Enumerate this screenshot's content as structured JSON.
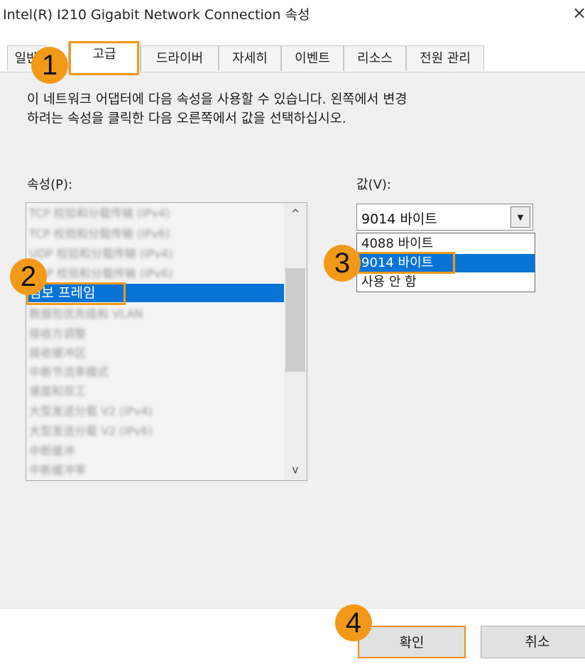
{
  "window": {
    "title": "Intel(R) I210 Gigabit Network Connection 속성",
    "close_glyph": "×"
  },
  "tabs": [
    {
      "label": "일반",
      "active": false
    },
    {
      "label": "고급",
      "active": true
    },
    {
      "label": "드라이버",
      "active": false
    },
    {
      "label": "자세히",
      "active": false
    },
    {
      "label": "이벤트",
      "active": false
    },
    {
      "label": "리소스",
      "active": false
    },
    {
      "label": "전원 관리",
      "active": false
    }
  ],
  "description": {
    "line1": "이 네트워크 어댑터에 다음 속성을 사용할 수 있습니다. 왼쪽에서 변경",
    "line2": "하려는 속성을 클릭한 다음 오른쪽에서 값을 선택하십시오."
  },
  "property_label": "속성(P):",
  "value_label": "값(V):",
  "properties": [
    {
      "label": "TCP 校验和分载传输 (IPv4)",
      "blurred": true
    },
    {
      "label": "TCP 校验和分载传输 (IPv6)",
      "blurred": true
    },
    {
      "label": "UDP 校验和分载传输 (IPv4)",
      "blurred": true
    },
    {
      "label": "UDP 校验和分载传输 (IPv6)",
      "blurred": true
    },
    {
      "label": "점보 프레임",
      "blurred": false,
      "selected": true
    },
    {
      "label": "数据包优先级和 VLAN",
      "blurred": true
    },
    {
      "label": "接收方调整",
      "blurred": true
    },
    {
      "label": "接收缓冲区",
      "blurred": true
    },
    {
      "label": "中断节流率模式",
      "blurred": true
    },
    {
      "label": "速度和双工",
      "blurred": true
    },
    {
      "label": "大型发送分载 V2 (IPv4)",
      "blurred": true
    },
    {
      "label": "大型发送分载 V2 (IPv6)",
      "blurred": true
    },
    {
      "label": "中断缓冲",
      "blurred": true
    },
    {
      "label": "中断缓冲率",
      "blurred": true
    }
  ],
  "value_combo": {
    "selected": "9014 바이트",
    "arrow_glyph": "▼"
  },
  "value_options": [
    {
      "label": "4088 바이트",
      "selected": false
    },
    {
      "label": "9014 바이트",
      "selected": true
    },
    {
      "label": "사용 안 함",
      "selected": false
    }
  ],
  "scroll": {
    "up_glyph": "^",
    "down_glyph": "v"
  },
  "buttons": {
    "ok": "확인",
    "cancel": "취소"
  },
  "markers": [
    "1",
    "2",
    "3",
    "4"
  ],
  "colors": {
    "highlight": "#0a74d6",
    "annotation": "#f29a18"
  }
}
